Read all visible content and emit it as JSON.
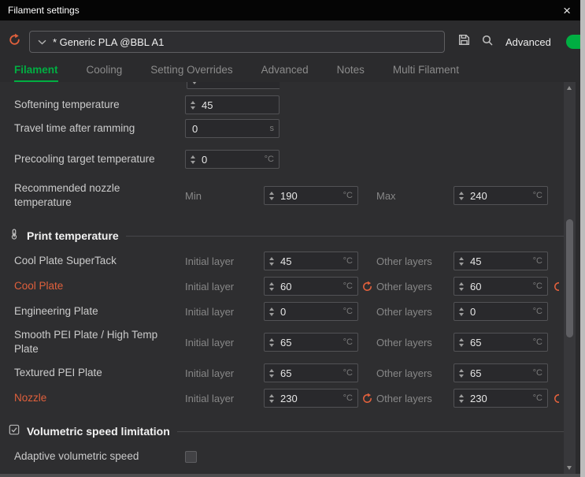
{
  "window": {
    "title": "Filament settings",
    "close_glyph": "×"
  },
  "preset_bar": {
    "preset_name": "* Generic PLA @BBL A1",
    "advanced_label": "Advanced",
    "advanced_toggle_state": "on"
  },
  "tabs": {
    "items": [
      {
        "label": "Filament",
        "active": true
      },
      {
        "label": "Cooling",
        "active": false
      },
      {
        "label": "Setting Overrides",
        "active": false
      },
      {
        "label": "Advanced",
        "active": false
      },
      {
        "label": "Notes",
        "active": false
      },
      {
        "label": "Multi Filament",
        "active": false
      }
    ]
  },
  "filament_settings": {
    "softening_temperature": {
      "label": "Softening temperature",
      "value": "45"
    },
    "travel_time_after_ramming": {
      "label": "Travel time after ramming",
      "value": "0",
      "unit": "s"
    },
    "precooling_target_temperature": {
      "label": "Precooling target temperature",
      "value": "0",
      "unit": "°C"
    },
    "recommended_nozzle_temperature": {
      "label": "Recommended nozzle temperature",
      "min_label": "Min",
      "min_value": "190",
      "max_label": "Max",
      "max_value": "240",
      "unit": "°C"
    }
  },
  "print_temperature": {
    "section_title": "Print temperature",
    "initial_layer_label": "Initial layer",
    "other_layers_label": "Other layers",
    "unit": "°C",
    "rows": [
      {
        "label": "Cool Plate SuperTack",
        "initial_layer": "45",
        "other_layers": "45",
        "modified": false
      },
      {
        "label": "Cool Plate",
        "initial_layer": "60",
        "other_layers": "60",
        "modified": true
      },
      {
        "label": "Engineering Plate",
        "initial_layer": "0",
        "other_layers": "0",
        "modified": false
      },
      {
        "label": "Smooth PEI Plate / High Temp Plate",
        "initial_layer": "65",
        "other_layers": "65",
        "modified": false
      },
      {
        "label": "Textured PEI Plate",
        "initial_layer": "65",
        "other_layers": "65",
        "modified": false
      },
      {
        "label": "Nozzle",
        "initial_layer": "230",
        "other_layers": "230",
        "modified": true
      }
    ]
  },
  "volumetric_speed": {
    "section_title": "Volumetric speed limitation",
    "adaptive_label": "Adaptive volumetric speed",
    "adaptive_checked": false
  },
  "colors": {
    "accent_green": "#00ae42",
    "modified_orange": "#e0603c"
  }
}
